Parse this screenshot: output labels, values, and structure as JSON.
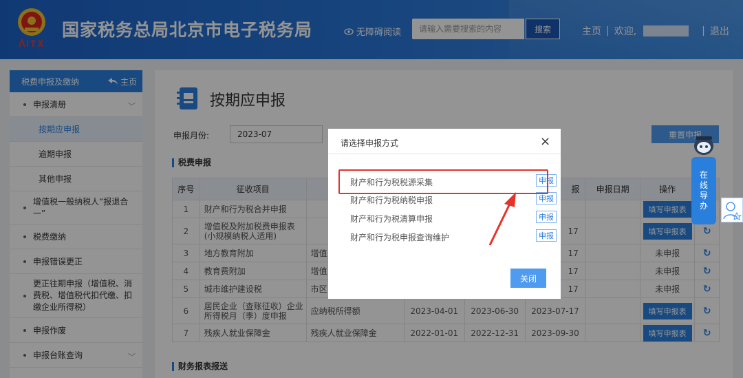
{
  "header": {
    "site_title": "国家税务总局北京市电子税务局",
    "accessibility": "无障碍阅读",
    "search_placeholder": "请输入需要搜索的内容",
    "search_button": "搜索",
    "home": "主页",
    "sep": "|",
    "welcome": "欢迎,",
    "logout": "退出"
  },
  "sidebar": {
    "header": "税费申报及缴纳",
    "home_link": "主页",
    "items": [
      {
        "label": "申报清册"
      },
      {
        "label": "按期应申报"
      },
      {
        "label": "逾期申报"
      },
      {
        "label": "其他申报"
      },
      {
        "label": "增值税一般纳税人“报退合一”"
      },
      {
        "label": "税费缴纳"
      },
      {
        "label": "申报错误更正"
      },
      {
        "label": "更正往期申报（增值税、消费税、增值税代扣代缴、扣缴企业所得税）"
      },
      {
        "label": "申报作废"
      },
      {
        "label": "申报台账查询"
      }
    ]
  },
  "main": {
    "page_title": "按期应申报",
    "month_label": "申报月份:",
    "month_value": "2023-07",
    "reset_button": "重置申报",
    "section_tax": "税费申报",
    "section_finance": "财务报表报送",
    "table": {
      "headers": [
        "序号",
        "征收项目",
        "报",
        "申报日期",
        "操作"
      ],
      "rows": [
        {
          "no": "1",
          "item": "财产和行为税合并申报",
          "sub": "",
          "start": "",
          "end": "",
          "deadline": "",
          "date": "",
          "op": "填写申报表",
          "refresh": false
        },
        {
          "no": "2",
          "item": "增值税及附加税费申报表(小规模纳税人适用)",
          "sub": "",
          "start": "",
          "end": "",
          "deadline": "17",
          "date": "",
          "op": "填写申报表",
          "refresh": true
        },
        {
          "no": "3",
          "item": "地方教育附加",
          "sub": "增值",
          "start": "",
          "end": "",
          "deadline": "17",
          "date": "",
          "op": "未申报",
          "refresh": true
        },
        {
          "no": "4",
          "item": "教育费附加",
          "sub": "增值",
          "start": "",
          "end": "",
          "deadline": "17",
          "date": "",
          "op": "未申报",
          "refresh": true
        },
        {
          "no": "5",
          "item": "城市维护建设税",
          "sub": "市区",
          "start": "",
          "end": "",
          "deadline": "17",
          "date": "",
          "op": "未申报",
          "refresh": true
        },
        {
          "no": "6",
          "item": "居民企业（查账征收）企业所得税月（季）度申报",
          "sub": "应纳税所得额",
          "start": "2023-04-01",
          "end": "2023-06-30",
          "deadline": "2023-07-17",
          "date": "",
          "op": "填写申报表",
          "refresh": true
        },
        {
          "no": "7",
          "item": "残疾人就业保障金",
          "sub": "残疾人就业保障金",
          "start": "2022-01-01",
          "end": "2022-12-31",
          "deadline": "2023-09-30",
          "date": "",
          "op": "填写申报表",
          "refresh": true
        }
      ]
    }
  },
  "modal": {
    "title": "请选择申报方式",
    "options": [
      {
        "label": "财产和行为税税源采集",
        "button": "申报"
      },
      {
        "label": "财产和行为税纳税申报",
        "button": "申报"
      },
      {
        "label": "财产和行为税清算申报",
        "button": "申报"
      },
      {
        "label": "财产和行为税申报查询维护",
        "button": "申报"
      }
    ],
    "close_button": "关闭"
  },
  "float": {
    "online_guide": [
      "在",
      "线",
      "导",
      "办"
    ]
  },
  "colors": {
    "brand_blue": "#2a7fdc",
    "header_blue": "#1d63c9",
    "highlight_red": "#e5332a"
  }
}
